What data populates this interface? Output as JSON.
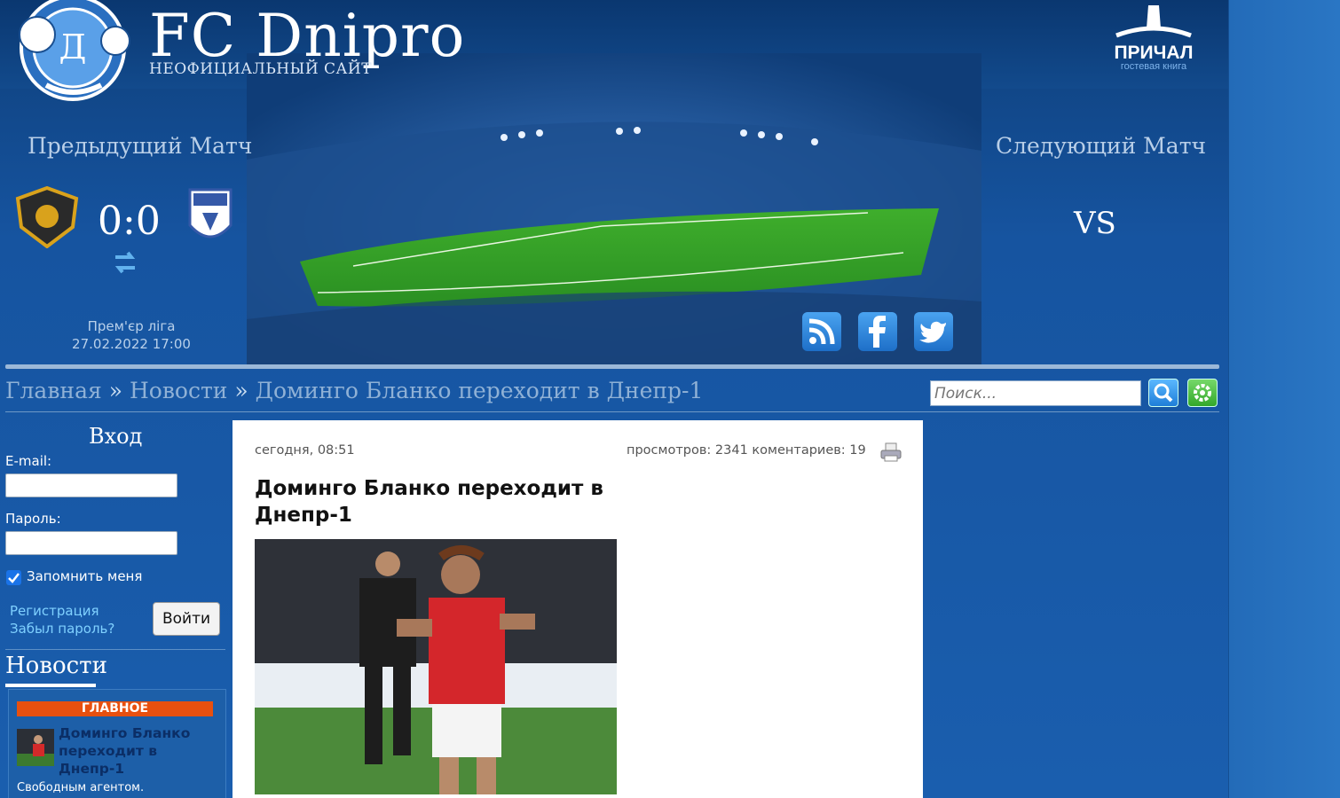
{
  "header": {
    "brand": "FC Dnipro",
    "subtitle": "НЕОФИЦИАЛЬНЫЙ САЙТ",
    "guestbook": {
      "name": "ПРИЧАЛ",
      "sub": "гостевая книга"
    }
  },
  "prev_match": {
    "title": "Предыдущий Матч",
    "score": "0:0",
    "league": "Прем'єр ліга",
    "datetime": "27.02.2022 17:00"
  },
  "next_match": {
    "title": "Следующий Матч",
    "vs": "VS"
  },
  "social": [
    "rss-icon",
    "facebook-icon",
    "twitter-icon"
  ],
  "breadcrumb": {
    "home": "Главная",
    "sep": "»",
    "news": "Новости",
    "current": "Доминго Бланко переходит в Днепр-1"
  },
  "search": {
    "placeholder": "Поиск..."
  },
  "login": {
    "title": "Вход",
    "email_label": "E-mail:",
    "password_label": "Пароль:",
    "remember_label": "Запомнить меня",
    "register_link": "Регистрация",
    "forgot_link": "Забыл пароль?",
    "submit_label": "Войти"
  },
  "news_block": {
    "title": "Новости",
    "badge": "ГЛАВНОЕ",
    "item_title": "Доминго Бланко переходит в Днепр-1",
    "item_desc": "Свободным агентом."
  },
  "article": {
    "date": "сегодня, 08:51",
    "stats": "просмотров: 2341 коментариев: 19",
    "title": "Доминго Бланко переходит в Днепр-1"
  },
  "colors": {
    "accent": "#1a5eae",
    "badge": "#e8500f",
    "link": "#7fd0ff"
  }
}
